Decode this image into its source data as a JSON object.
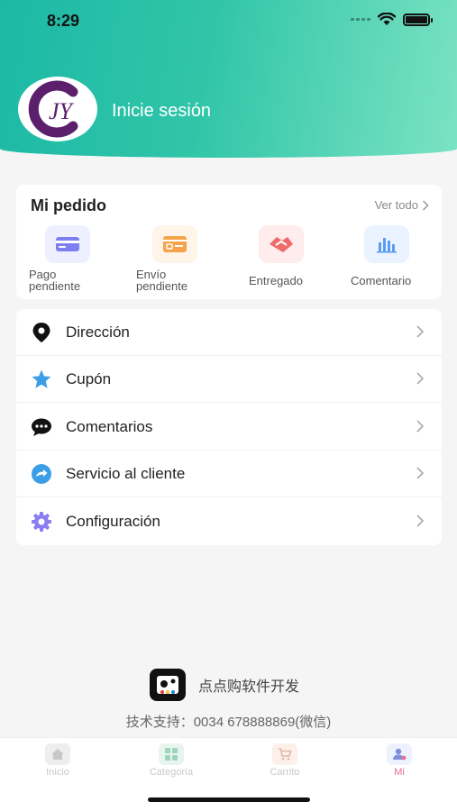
{
  "status_bar": {
    "time": "8:29"
  },
  "header": {
    "logo_text": "JY",
    "login_label": "Inicie sesión"
  },
  "orders": {
    "title": "Mi pedido",
    "view_all": "Ver todo",
    "items": [
      {
        "line1": "Pago",
        "line2": "pendiente",
        "icon": "card-icon",
        "color": "#7b7ff0"
      },
      {
        "line1": "Envío",
        "line2": "pendiente",
        "icon": "shipping-icon",
        "color": "#f5a24b"
      },
      {
        "line1": "Entregado",
        "line2": "",
        "icon": "handshake-icon",
        "color": "#f06a6a"
      },
      {
        "line1": "Comentario",
        "line2": "",
        "icon": "bar-chart-icon",
        "color": "#5b9cf0"
      }
    ]
  },
  "menu": {
    "items": [
      {
        "label": "Dirección",
        "icon": "location-pin-icon"
      },
      {
        "label": "Cupón",
        "icon": "star-icon",
        "color": "#3d9ee8"
      },
      {
        "label": "Comentarios",
        "icon": "chat-bubble-icon"
      },
      {
        "label": "Servicio al cliente",
        "icon": "share-arrow-icon",
        "color": "#3d9ee8"
      },
      {
        "label": "Configuración",
        "icon": "gear-icon",
        "color": "#8a7cf2"
      }
    ]
  },
  "footer": {
    "brand_name": "点点购软件开发",
    "support": "技术支持：0034 678888869(微信)"
  },
  "tabbar": {
    "items": [
      {
        "label": "Inicio",
        "icon": "home-icon"
      },
      {
        "label": "Categoría",
        "icon": "grid-icon"
      },
      {
        "label": "Carrito",
        "icon": "cart-icon"
      },
      {
        "label": "Mi",
        "icon": "user-icon",
        "active": true,
        "active_color": "#e8708f"
      }
    ]
  }
}
